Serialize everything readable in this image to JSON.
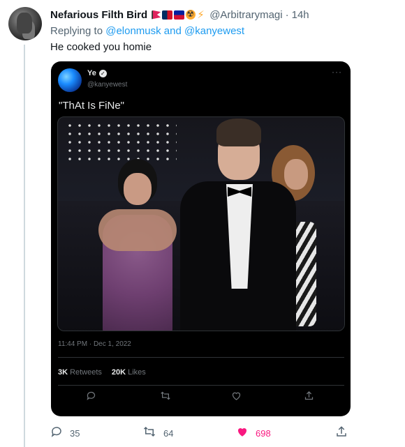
{
  "tweet": {
    "display_name": "Nefarious Filth Bird",
    "handle": "@Arbitrarymagi",
    "separator": "·",
    "time": "14h",
    "replying_prefix": "Replying to ",
    "replying_to": "@elonmusk and @kanyewest",
    "text": "He cooked you homie",
    "name_emojis": [
      "red-flag-icon",
      "dominican-flag-icon",
      "haiti-flag-icon",
      "radioactive-icon",
      "lightning-icon"
    ]
  },
  "embedded": {
    "name": "Ye",
    "verified_glyph": "✓",
    "handle": "@kanyewest",
    "more": "···",
    "text": "\"ThAt Is FiNe\"",
    "date": "11:44 PM · Dec 1, 2022",
    "retweets_count": "3K",
    "retweets_label": "Retweets",
    "likes_count": "20K",
    "likes_label": "Likes",
    "icons": [
      "reply-icon",
      "retweet-icon",
      "like-icon",
      "share-icon"
    ]
  },
  "actions": {
    "reply_count": "35",
    "retweet_count": "64",
    "like_count": "698",
    "like_color": "#f91880",
    "accent": "#1d9bf0"
  }
}
